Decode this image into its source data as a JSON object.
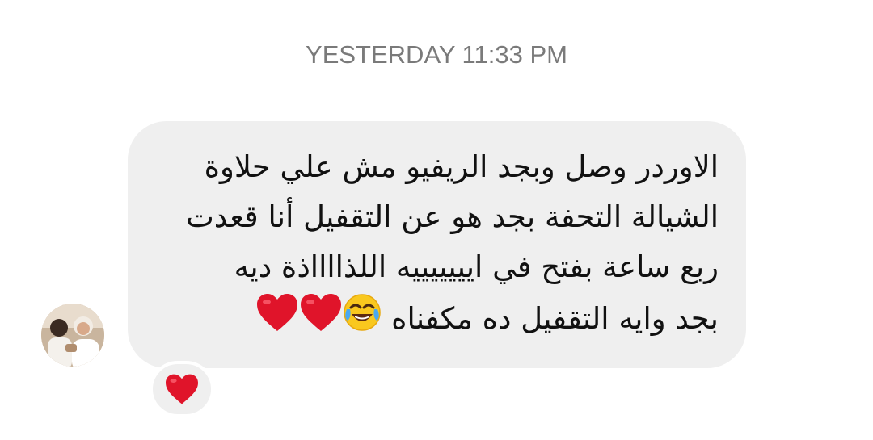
{
  "thread": {
    "timestamp": "YESTERDAY 11:33 PM"
  },
  "message": {
    "lines": [
      "الاوردر وصل وبجد الريفيو مش علي حلاوة",
      "الشيالة التحفة بجد هو عن التقفيل أنا قعدت",
      "ربع ساعة بفتح في  ايييييييه اللذااااذة ديه",
      "بجد وايه التقفيل ده مكفناه"
    ],
    "trailing_emoji": [
      "face-with-tears-of-joy-emoji",
      "red-heart-emoji",
      "red-heart-emoji"
    ]
  },
  "reaction": {
    "icon": "red-heart-icon"
  },
  "colors": {
    "bubble": "#efefef",
    "timestamp": "#7a7a7a",
    "heart": "#e0142a"
  }
}
